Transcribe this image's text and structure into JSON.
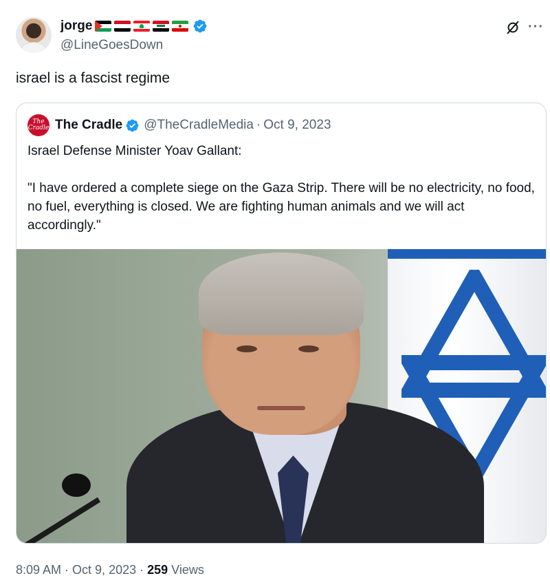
{
  "author": {
    "display_name": "jorge",
    "handle": "@LineGoesDown",
    "flags": [
      "palestine-flag",
      "egypt-flag",
      "lebanon-flag",
      "iraq-flag",
      "iran-flag"
    ],
    "verified": true
  },
  "tweet": {
    "text": "israel is a fascist regime",
    "time": "8:09 AM",
    "date": "Oct 9, 2023",
    "views_count": "259",
    "views_label": "Views"
  },
  "quote": {
    "avatar_text_top": "The",
    "avatar_text_bottom": "Cradle",
    "display_name": "The Cradle",
    "handle": "@TheCradleMedia",
    "separator": "·",
    "date": "Oct 9, 2023",
    "verified": true,
    "paragraphs": [
      "Israel Defense Minister Yoav Gallant:",
      "\"I have ordered a complete siege on the Gaza Strip. There will be no electricity, no food, no fuel, everything is closed. We are fighting human animals and we will act accordingly.\""
    ]
  },
  "colors": {
    "verified_blue": "#1d9bf0",
    "secondary_text": "#536471",
    "primary_text": "#0f1419",
    "border": "#cfd9de"
  },
  "icons": {
    "grok": "grok-icon",
    "more": "more-options-icon"
  },
  "separator": "·"
}
